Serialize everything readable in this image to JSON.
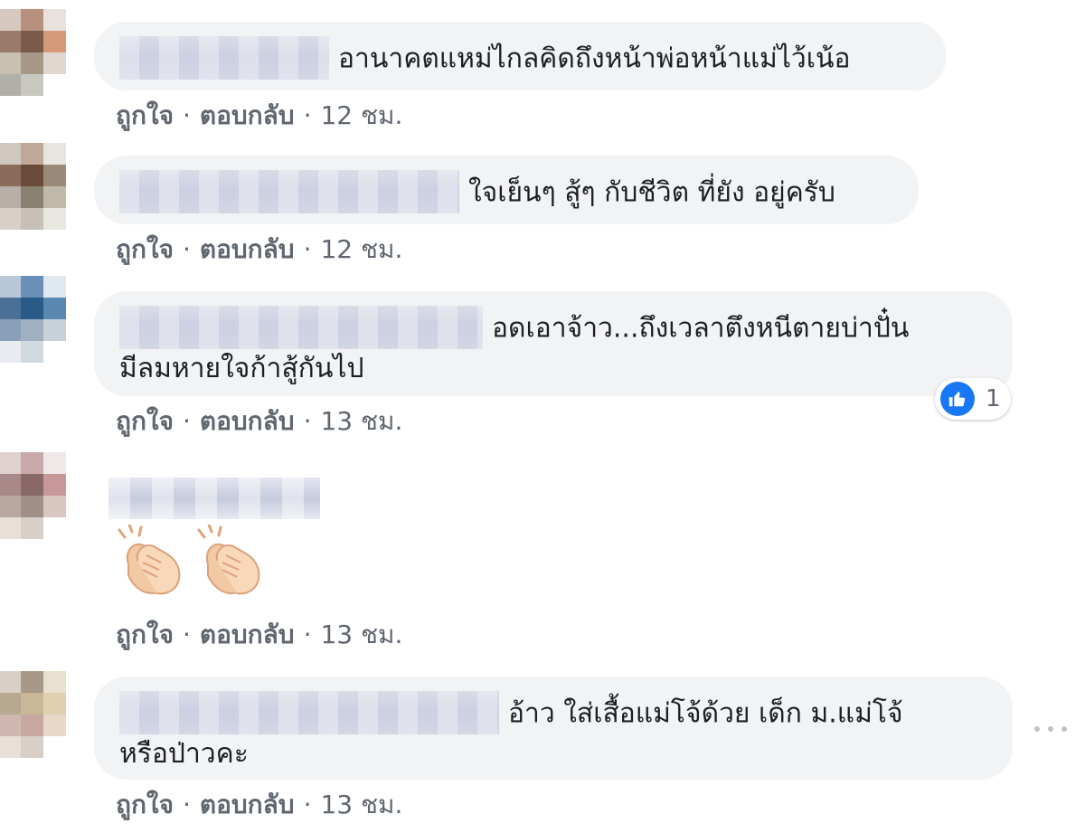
{
  "comments": [
    {
      "text": "อานาคตแหม่ไกลคิดถึงหน้าพ่อหน้าแม่ไว้เน้อ",
      "actions": {
        "like": "ถูกใจ",
        "reply": "ตอบกลับ",
        "time": "12 ชม."
      }
    },
    {
      "text": "ใจเย็นๆ สู้ๆ กับชีวิต ที่ยัง อยู่ครับ",
      "actions": {
        "like": "ถูกใจ",
        "reply": "ตอบกลับ",
        "time": "12 ชม."
      }
    },
    {
      "text_line1": "อดเอาจ้าว...ถึงเวลาตึงหนีตายบ่าปั๋น",
      "text_line2": "มีลมหายใจก้าสู้กันไป",
      "reaction_count": "1",
      "actions": {
        "like": "ถูกใจ",
        "reply": "ตอบกลับ",
        "time": "13 ชม."
      }
    },
    {
      "emoji": "clapping-hands",
      "actions": {
        "like": "ถูกใจ",
        "reply": "ตอบกลับ",
        "time": "13 ชม."
      }
    },
    {
      "text_line1": "อ้าว ใส่เสื้อแม่โจ้ด้วย เด็ก ม.แม่โจ้",
      "text_line2": "หรือป่าวคะ",
      "actions": {
        "like": "ถูกใจ",
        "reply": "ตอบกลับ",
        "time": "13 ชม."
      }
    }
  ],
  "separator": "·",
  "colors": {
    "bubble": "#f2f3f5",
    "text": "#1c1e21",
    "secondary": "#606770",
    "like_blue": "#1877f2"
  }
}
